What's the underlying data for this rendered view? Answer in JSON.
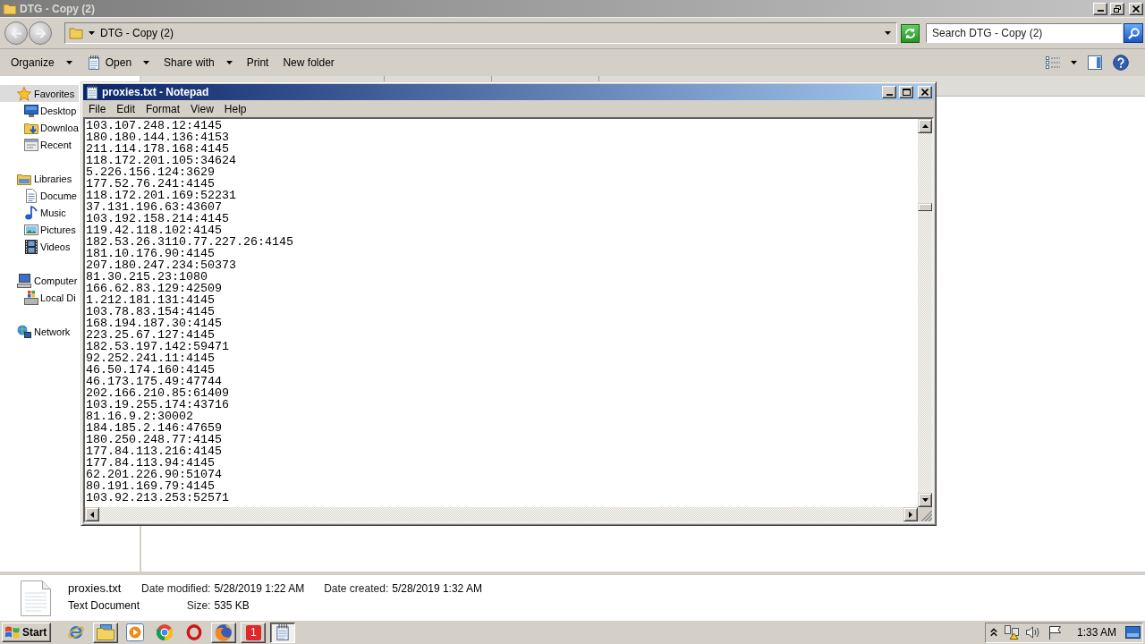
{
  "explorer": {
    "title": "DTG - Copy (2)",
    "address": {
      "path": "DTG - Copy (2)"
    },
    "search": {
      "placeholder": "Search DTG - Copy (2)"
    },
    "toolbar": [
      {
        "label": "Organize",
        "dropdown": true
      },
      {
        "label": "Open",
        "dropdown": true
      },
      {
        "label": "Share with",
        "dropdown": true
      },
      {
        "label": "Print",
        "dropdown": false
      },
      {
        "label": "New folder",
        "dropdown": false
      }
    ],
    "navigation": [
      {
        "label": "Favorites",
        "selected": true,
        "children": [
          {
            "label": "Desktop",
            "selected": false
          },
          {
            "label": "Downloa",
            "selected": false
          },
          {
            "label": "Recent",
            "selected": false
          }
        ]
      },
      {
        "label": "Libraries",
        "selected": false,
        "children": [
          {
            "label": "Docume",
            "selected": false
          },
          {
            "label": "Music",
            "selected": false
          },
          {
            "label": "Pictures",
            "selected": false
          },
          {
            "label": "Videos",
            "selected": false
          }
        ]
      },
      {
        "label": "Computer",
        "selected": false,
        "children": [
          {
            "label": "Local Di",
            "selected": false
          }
        ]
      },
      {
        "label": "Network",
        "selected": false
      }
    ],
    "details": {
      "name": "proxies.txt",
      "type": "Text Document",
      "columns": [
        [
          {
            "label": "Date modified:",
            "value": "5/28/2019 1:22 AM"
          },
          {
            "label": "Size:",
            "value": "535 KB"
          }
        ],
        [
          {
            "label": "Date created:",
            "value": "5/28/2019 1:32 AM"
          }
        ]
      ]
    }
  },
  "notepad": {
    "title": "proxies.txt - Notepad",
    "menu": [
      "File",
      "Edit",
      "Format",
      "View",
      "Help"
    ],
    "lines": [
      "103.107.248.12:4145",
      "180.180.144.136:4153",
      "211.114.178.168:4145",
      "118.172.201.105:34624",
      "5.226.156.124:3629",
      "177.52.76.241:4145",
      "118.172.201.169:52231",
      "37.131.196.63:43607",
      "103.192.158.214:4145",
      "119.42.118.102:4145",
      "182.53.26.3110.77.227.26:4145",
      "181.10.176.90:4145",
      "207.180.247.234:50373",
      "81.30.215.23:1080",
      "166.62.83.129:42509",
      "1.212.181.131:4145",
      "103.78.83.154:4145",
      "168.194.187.30:4145",
      "223.25.67.127:4145",
      "182.53.197.142:59471",
      "92.252.241.11:4145",
      "46.50.174.160:4145",
      "46.173.175.49:47744",
      "202.166.210.85:61409",
      "103.19.255.174:43716",
      "81.16.9.2:30002",
      "184.185.2.146:47659",
      "180.250.248.77:4145",
      "177.84.113.216:4145",
      "177.84.113.94:4145",
      "62.201.226.90:51074",
      "80.191.169.79:4145",
      "103.92.213.253:52571"
    ]
  },
  "taskbar": {
    "start": "Start",
    "items": [
      {
        "kind": "launcher",
        "selected": false
      },
      {
        "kind": "window",
        "selected": false
      },
      {
        "kind": "launcher",
        "selected": false
      },
      {
        "kind": "launcher",
        "selected": false
      },
      {
        "kind": "launcher",
        "selected": false
      },
      {
        "kind": "window",
        "selected": false
      },
      {
        "kind": "window",
        "selected": false,
        "text": "1"
      },
      {
        "kind": "window",
        "selected": true
      }
    ],
    "clock": "1:33 AM"
  }
}
